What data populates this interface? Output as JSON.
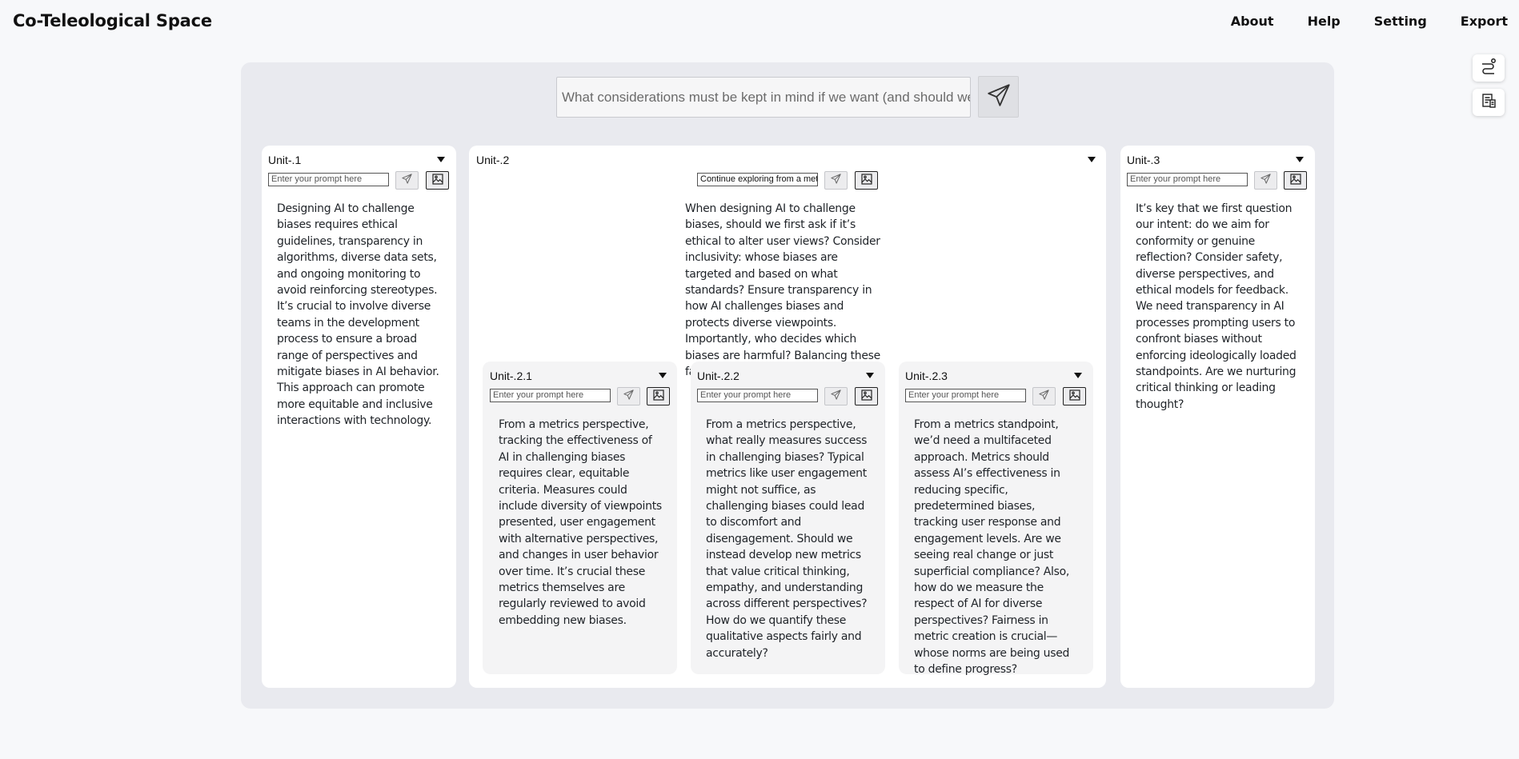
{
  "app": {
    "title": "Co-Teleological Space"
  },
  "nav": [
    {
      "label": "About"
    },
    {
      "label": "Help"
    },
    {
      "label": "Setting"
    },
    {
      "label": "Export"
    }
  ],
  "side_tools": [
    {
      "icon": "route-icon"
    },
    {
      "icon": "document-list-icon"
    }
  ],
  "main_prompt": {
    "value": "What considerations must be kept in mind  if we want (and should we) design AI to challenge biases?"
  },
  "units": {
    "u1": {
      "title": "Unit-.1",
      "prompt_placeholder": "Enter your prompt here",
      "text": "Designing AI to challenge biases requires ethical guidelines, transparency in algorithms, diverse data sets, and ongoing monitoring to avoid reinforcing stereotypes. It’s crucial to involve diverse teams in the development process to ensure a broad range of perspectives and mitigate biases in AI behavior. This approach can promote more equitable and inclusive interactions with technology."
    },
    "u2": {
      "title": "Unit-.2",
      "prompt_value": "Continue exploring from a metrics perspective",
      "text": "When designing AI to challenge biases, should we first ask if it’s ethical to alter user views? Consider inclusivity: whose biases are targeted and based on what standards? Ensure transparency in how AI challenges biases and protects diverse viewpoints. Importantly, who decides which biases are harmful? Balancing these factors is key."
    },
    "u21": {
      "title": "Unit-.2.1",
      "prompt_placeholder": "Enter your prompt here",
      "text": "From a metrics perspective, tracking the effectiveness of AI in challenging biases requires clear, equitable criteria. Measures could include diversity of viewpoints presented, user engagement with alternative perspectives, and changes in user behavior over time. It’s crucial these metrics themselves are regularly reviewed to avoid embedding new biases."
    },
    "u22": {
      "title": "Unit-.2.2",
      "prompt_placeholder": "Enter your prompt here",
      "text": "From a metrics perspective, what really measures success in challenging biases? Typical metrics like user engagement might not suffice, as challenging biases could lead to discomfort and disengagement. Should we instead develop new metrics that value critical thinking, empathy, and understanding across different perspectives? How do we quantify these qualitative aspects fairly and accurately?"
    },
    "u23": {
      "title": "Unit-.2.3",
      "prompt_placeholder": "Enter your prompt here",
      "text": "From a metrics standpoint, we’d need a multifaceted approach. Metrics should assess AI’s effectiveness in reducing specific, predetermined biases, tracking user response and engagement levels. Are we seeing real change or just superficial compliance? Also, how do we measure the respect of AI for diverse perspectives? Fairness in metric creation is crucial—whose norms are being used to define progress?"
    },
    "u3": {
      "title": "Unit-.3",
      "prompt_placeholder": "Enter your prompt here",
      "text": "It’s key that we first question our intent: do we aim for conformity or genuine reflection? Consider safety, diverse perspectives, and ethical models for feedback. We need transparency in AI processes prompting users to confront biases without enforcing ideologically loaded standpoints. Are we nurturing critical thinking or leading thought?"
    }
  }
}
